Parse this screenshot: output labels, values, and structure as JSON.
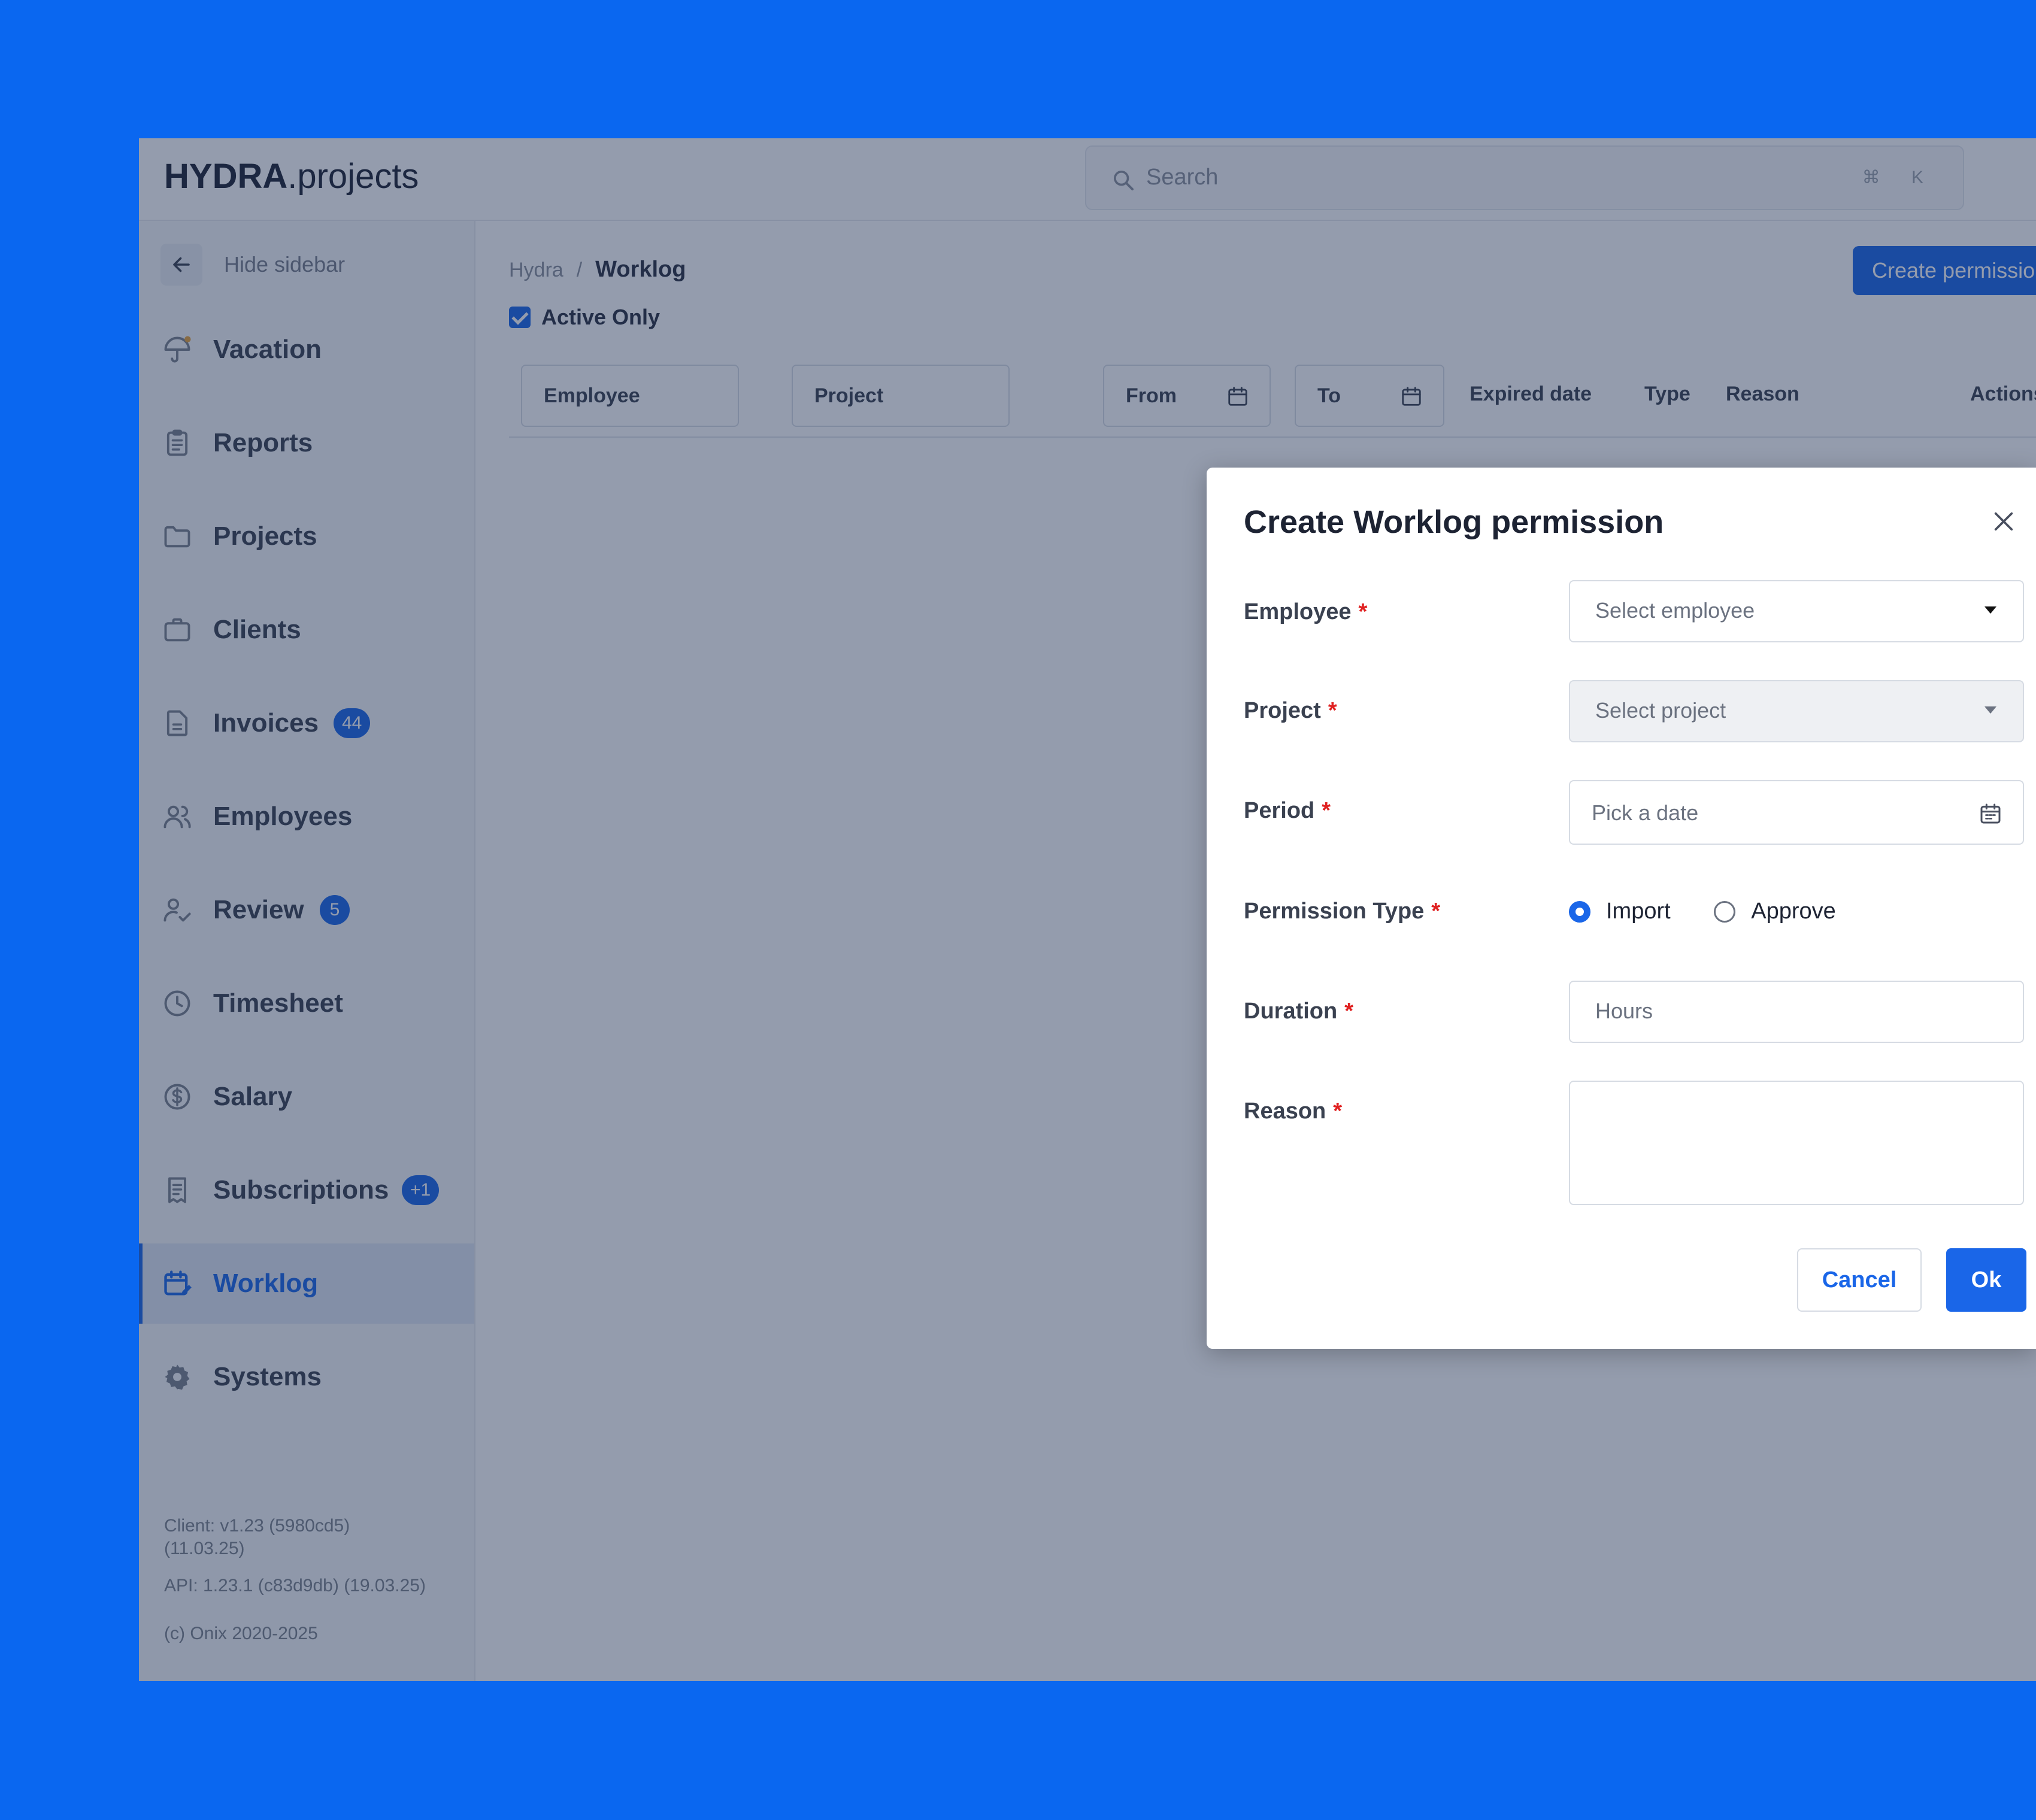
{
  "app": {
    "logo_brand": "HYDRA",
    "logo_suffix": ".projects"
  },
  "search": {
    "placeholder": "Search",
    "shortcut": "⌘ K",
    "icon": "search-icon"
  },
  "sidebar": {
    "hide_label": "Hide sidebar",
    "items": [
      {
        "label": "Vacation",
        "icon": "umbrella-icon"
      },
      {
        "label": "Reports",
        "icon": "clipboard-icon"
      },
      {
        "label": "Projects",
        "icon": "folder-icon"
      },
      {
        "label": "Clients",
        "icon": "briefcase-icon"
      },
      {
        "label": "Invoices",
        "icon": "document-icon",
        "badge": "44"
      },
      {
        "label": "Employees",
        "icon": "users-icon"
      },
      {
        "label": "Review",
        "icon": "user-check-icon",
        "badge": "5"
      },
      {
        "label": "Timesheet",
        "icon": "clock-icon"
      },
      {
        "label": "Salary",
        "icon": "dollar-icon"
      },
      {
        "label": "Subscriptions",
        "icon": "receipt-icon",
        "badge": "+1"
      },
      {
        "label": "Worklog",
        "icon": "calendar-edit-icon",
        "active": true
      },
      {
        "label": "Systems",
        "icon": "gear-icon"
      }
    ],
    "footer": {
      "client_version": "Client: v1.23 (5980cd5) (11.03.25)",
      "api_version": "API: 1.23.1 (c83d9db) (19.03.25)",
      "copyright": "(c) Onix 2020-2025"
    }
  },
  "main": {
    "breadcrumb": {
      "root": "Hydra",
      "separator": "/",
      "current": "Worklog"
    },
    "create_button": "Create permission",
    "active_only_label": "Active Only",
    "table_headers": {
      "employee": "Employee",
      "project": "Project",
      "from": "From",
      "to": "To",
      "expired_date": "Expired date",
      "type": "Type",
      "reason": "Reason",
      "actions": "Actions"
    }
  },
  "modal": {
    "title": "Create Worklog permission",
    "fields": {
      "employee": {
        "label": "Employee",
        "placeholder": "Select employee"
      },
      "project": {
        "label": "Project",
        "placeholder": "Select project"
      },
      "period": {
        "label": "Period",
        "placeholder": "Pick a date"
      },
      "permission_type": {
        "label": "Permission Type",
        "options": [
          "Import",
          "Approve"
        ],
        "selected": "Import"
      },
      "duration": {
        "label": "Duration",
        "placeholder": "Hours"
      },
      "reason": {
        "label": "Reason",
        "placeholder": ""
      }
    },
    "required_marker": "*",
    "cancel_label": "Cancel",
    "ok_label": "Ok"
  },
  "colors": {
    "accent": "#1a66e8",
    "background": "#0a67f0",
    "required": "#e02020"
  }
}
